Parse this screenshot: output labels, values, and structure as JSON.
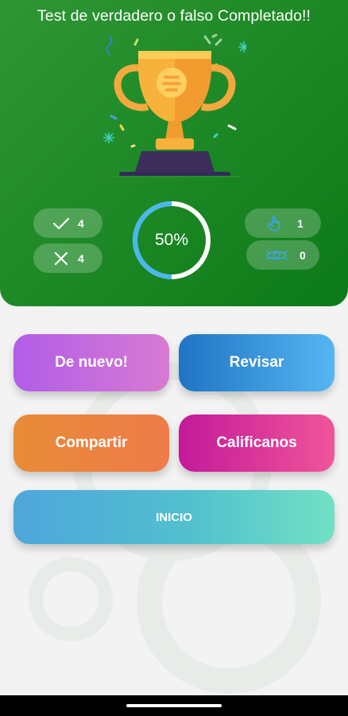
{
  "header": {
    "title": "Test de verdadero o falso Completado!!",
    "background_color": "#1f8a27"
  },
  "trophy": {
    "icon": "trophy-icon"
  },
  "stats": {
    "correct": {
      "icon": "check-icon",
      "value": "4"
    },
    "wrong": {
      "icon": "close-icon",
      "value": "4"
    },
    "hints": {
      "icon": "hint-hand-icon",
      "value": "1"
    },
    "skipped": {
      "icon": "skip-eye-icon",
      "value": "0"
    }
  },
  "progress": {
    "label": "50%",
    "fraction": 0.5,
    "fill_color": "#4ab7ef",
    "track_color": "#ffffff"
  },
  "buttons": {
    "again": "De nuevo!",
    "review": "Revisar",
    "share": "Compartir",
    "rate": "Calificanos",
    "home": "INICIO"
  },
  "colors": {
    "again": "#b15de8",
    "review": "#1f74c4",
    "share": "#e88c37",
    "rate": "#c3199a",
    "home": "#4ea6db"
  }
}
